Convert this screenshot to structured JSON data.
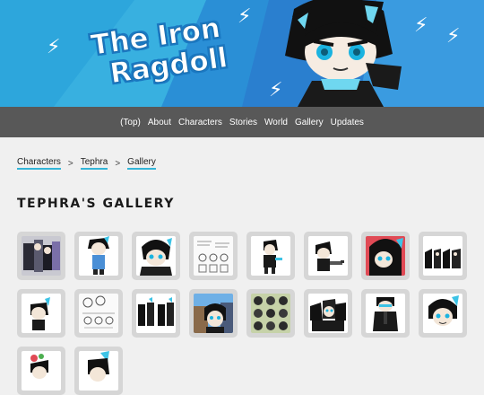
{
  "site": {
    "title_line1": "The Iron",
    "title_line2": "Ragdoll"
  },
  "nav": {
    "items": [
      {
        "label": "(Top)"
      },
      {
        "label": "About"
      },
      {
        "label": "Characters"
      },
      {
        "label": "Stories"
      },
      {
        "label": "World"
      },
      {
        "label": "Gallery"
      },
      {
        "label": "Updates"
      }
    ]
  },
  "breadcrumb": {
    "items": [
      {
        "label": "Characters"
      },
      {
        "label": "Tephra"
      },
      {
        "label": "Gallery"
      }
    ],
    "separator": ">"
  },
  "page": {
    "title": "Tephra's Gallery"
  },
  "gallery": {
    "thumbnail_count": 18
  },
  "colors": {
    "banner_blue": "#2aa3d9",
    "banner_dark_blue": "#1f7dc4",
    "nav_bg": "#585858",
    "link_underline": "#33b5d8",
    "page_bg": "#f0f0f0",
    "tile_bg": "#d6d6d6"
  }
}
